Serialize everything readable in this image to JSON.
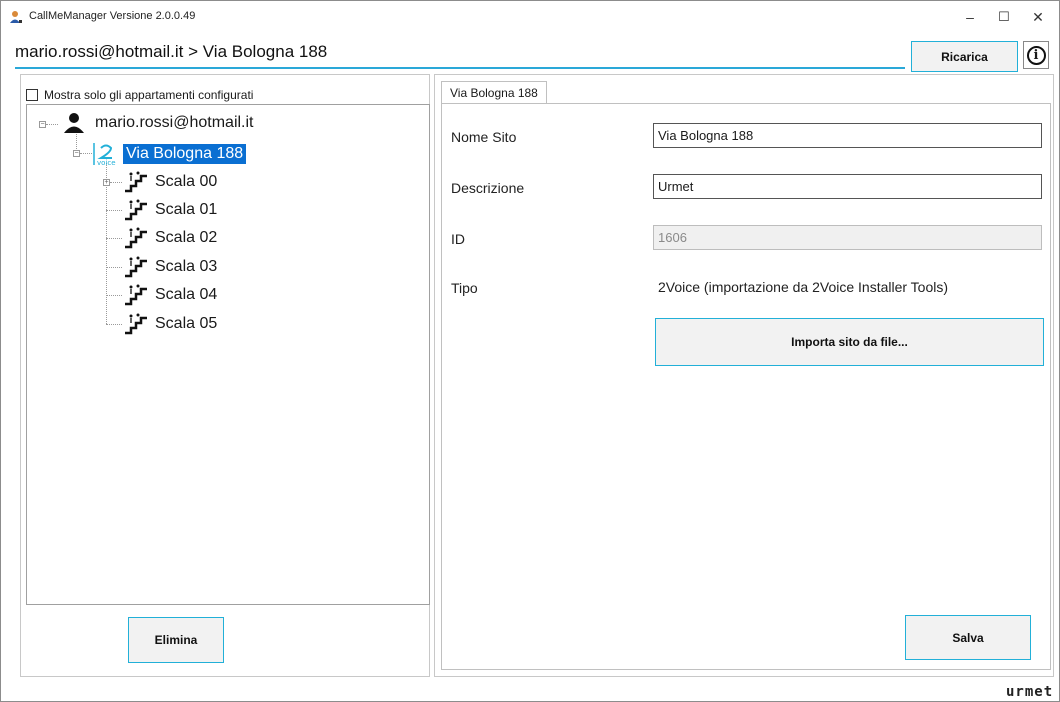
{
  "window": {
    "title": "CallMeManager Versione 2.0.0.49",
    "controls": {
      "minimize": "–",
      "maximize": "☐",
      "close": "✕"
    }
  },
  "header": {
    "path": "mario.rossi@hotmail.it > Via Bologna 188",
    "reload_label": "Ricarica",
    "info_symbol": "i"
  },
  "left": {
    "checkbox_label": "Mostra solo gli appartamenti configurati",
    "delete_label": "Elimina",
    "tree": {
      "root": "mario.rossi@hotmail.it",
      "site": "Via Bologna 188",
      "scale": [
        "Scala 00",
        "Scala 01",
        "Scala 02",
        "Scala 03",
        "Scala 04",
        "Scala 05"
      ]
    }
  },
  "right": {
    "tab_label": "Via Bologna 188",
    "name_label": "Nome Sito",
    "name_value": "Via Bologna 188",
    "desc_label": "Descrizione",
    "desc_value": "Urmet",
    "id_label": "ID",
    "id_value": "1606",
    "type_label": "Tipo",
    "type_value": "2Voice (importazione da 2Voice Installer Tools)",
    "import_label": "Importa sito da file...",
    "save_label": "Salva"
  },
  "footer": {
    "brand": "urmet"
  },
  "colors": {
    "accent": "#22b0d8",
    "selection": "#0a6fd2"
  },
  "icons": [
    "user-icon",
    "2voice-icon",
    "stairs-icon",
    "info-icon"
  ]
}
